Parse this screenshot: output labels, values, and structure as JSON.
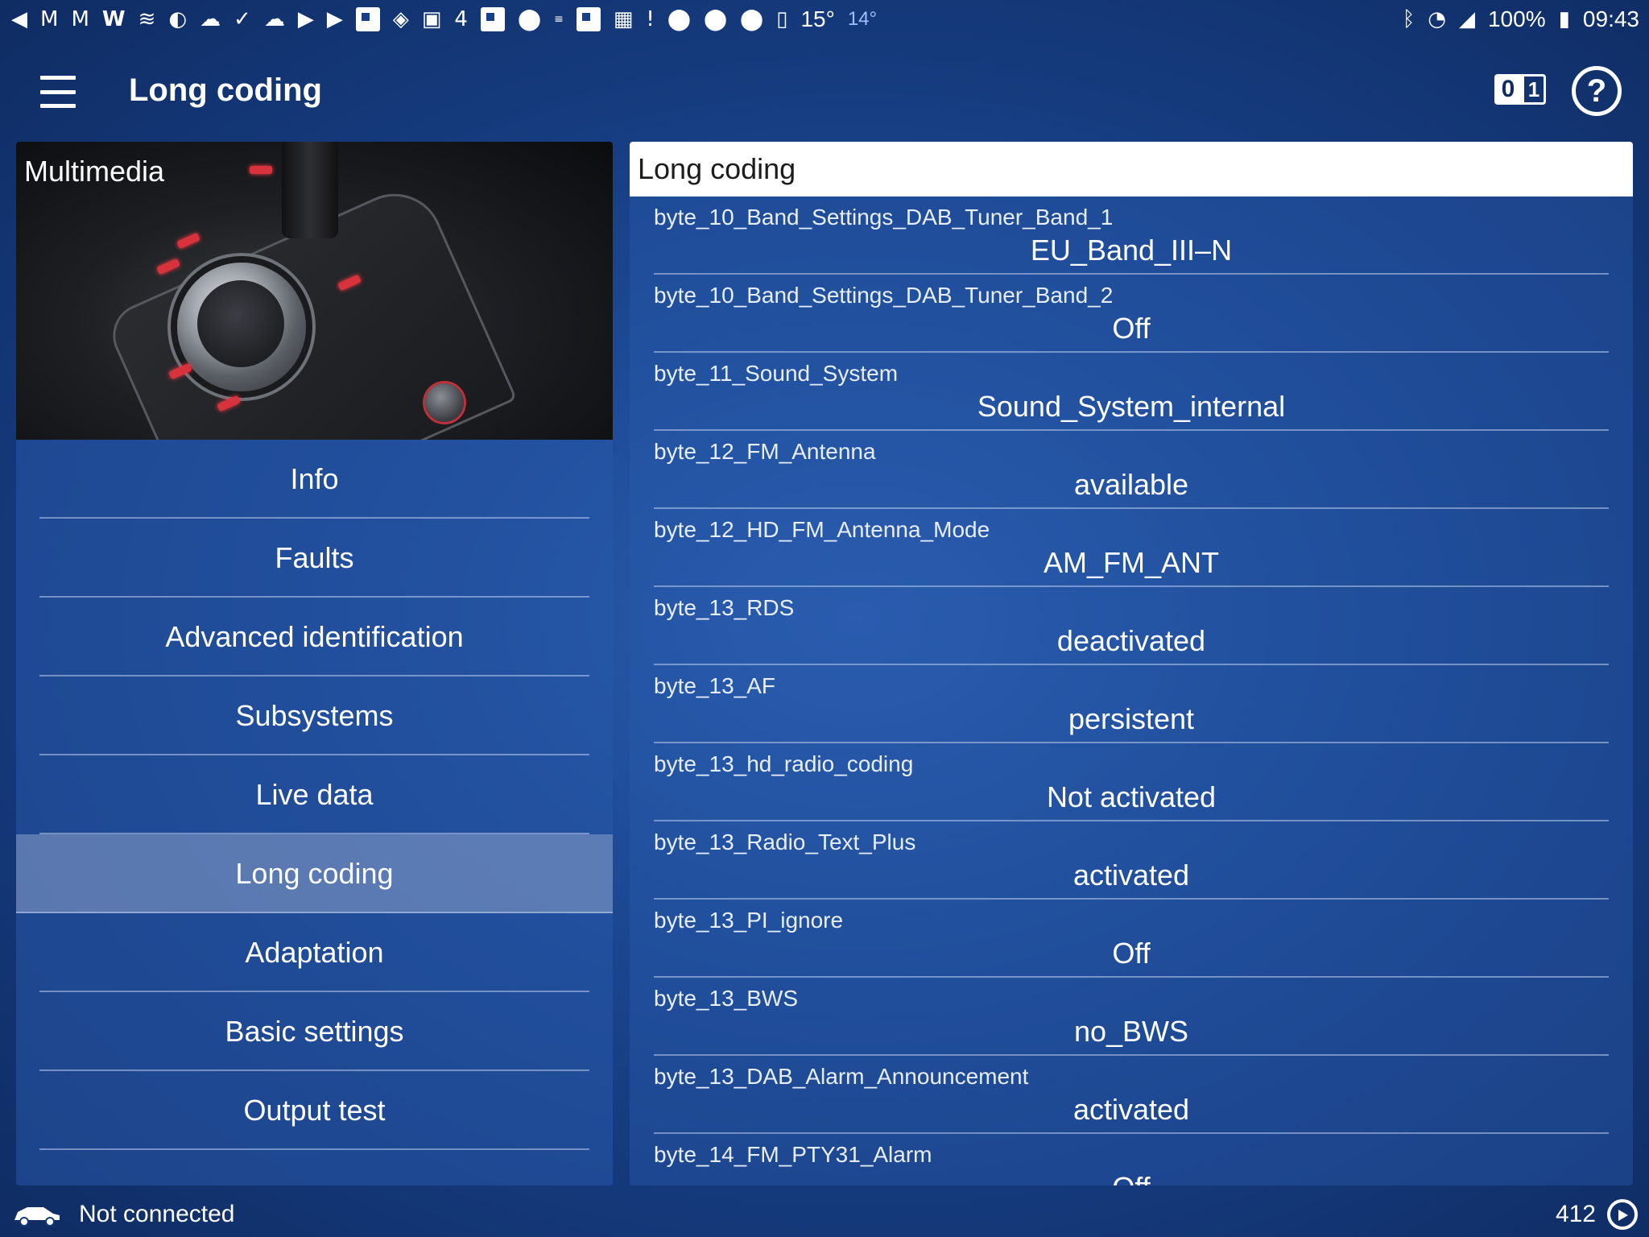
{
  "status_bar": {
    "left_icons": [
      "volume-icon",
      "gmail-icon",
      "gmail-icon",
      "wikipedia-icon",
      "layers-icon",
      "globe-icon",
      "cloud-sync-icon",
      "check-icon",
      "cloud-icon",
      "youtube-icon",
      "youtube-icon",
      "flipboard-icon",
      "app-icon",
      "image-icon",
      "channel4-icon",
      "flipboard-icon",
      "location-icon",
      "bbc-news-icon",
      "flipboard-icon",
      "calendar-icon",
      "alert-icon",
      "location-icon",
      "location-icon",
      "location-icon",
      "dictionary-icon"
    ],
    "temp_high": "15°",
    "temp_low": "14°",
    "battery": "100%",
    "time": "09:43"
  },
  "app_bar": {
    "title": "Long coding",
    "binary_zero": "0",
    "binary_one": "1",
    "help_glyph": "?"
  },
  "module": {
    "title": "Multimedia"
  },
  "menu": [
    {
      "label": "Info"
    },
    {
      "label": "Faults"
    },
    {
      "label": "Advanced identification"
    },
    {
      "label": "Subsystems"
    },
    {
      "label": "Live data"
    },
    {
      "label": "Long coding",
      "active": true
    },
    {
      "label": "Adaptation"
    },
    {
      "label": "Basic settings"
    },
    {
      "label": "Output test"
    }
  ],
  "coding_panel": {
    "header": "Long coding",
    "rows": [
      {
        "name": "byte_10_Band_Settings_DAB_Tuner_Band_1",
        "value": "EU_Band_III–N"
      },
      {
        "name": "byte_10_Band_Settings_DAB_Tuner_Band_2",
        "value": "Off"
      },
      {
        "name": "byte_11_Sound_System",
        "value": "Sound_System_internal"
      },
      {
        "name": "byte_12_FM_Antenna",
        "value": "available"
      },
      {
        "name": "byte_12_HD_FM_Antenna_Mode",
        "value": "AM_FM_ANT"
      },
      {
        "name": "byte_13_RDS",
        "value": "deactivated"
      },
      {
        "name": "byte_13_AF",
        "value": "persistent"
      },
      {
        "name": "byte_13_hd_radio_coding",
        "value": "Not activated"
      },
      {
        "name": "byte_13_Radio_Text_Plus",
        "value": "activated"
      },
      {
        "name": "byte_13_PI_ignore",
        "value": "Off"
      },
      {
        "name": "byte_13_BWS",
        "value": "no_BWS"
      },
      {
        "name": "byte_13_DAB_Alarm_Announcement",
        "value": "activated"
      },
      {
        "name": "byte_14_FM_PTY31_Alarm",
        "value": "Off"
      }
    ]
  },
  "bottom_bar": {
    "connection_status": "Not connected",
    "counter": "412"
  }
}
